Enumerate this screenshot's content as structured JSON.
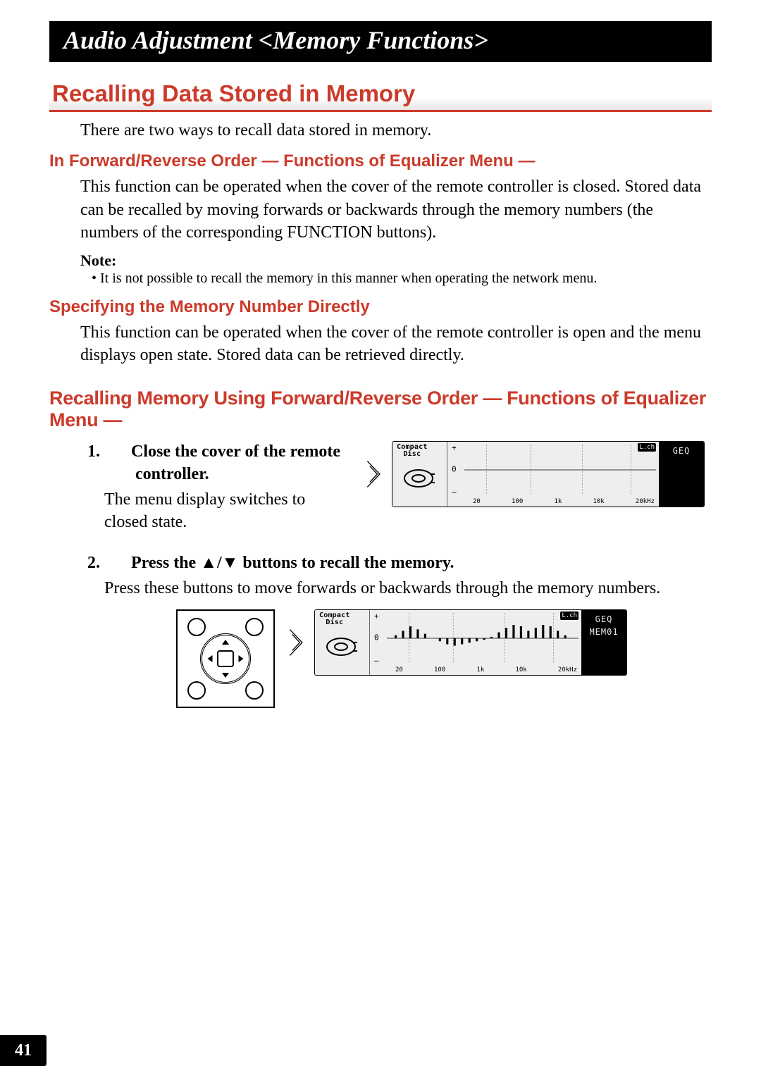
{
  "chapter_title": "Audio Adjustment <Memory Functions>",
  "section_title": "Recalling Data Stored in Memory",
  "intro_text": "There are two ways to recall data stored in memory.",
  "sub1": {
    "heading": "In Forward/Reverse Order — Functions of Equalizer Menu —",
    "body": "This function can be operated when the cover of the remote controller is closed. Stored data can be recalled by moving forwards or backwards through the memory numbers (the numbers of the corresponding FUNCTION buttons).",
    "note_label": "Note:",
    "note_text": "It is not possible to recall the memory in this manner when operating the network menu."
  },
  "sub2": {
    "heading": "Specifying the Memory Number Directly",
    "body": "This function can be operated when the cover of the remote controller is open and the menu displays open state. Stored data can be retrieved directly."
  },
  "procedure_heading": "Recalling Memory Using Forward/Reverse Order — Functions of Equalizer Menu —",
  "step1": {
    "num": "1.",
    "head": "Close the cover of the remote controller.",
    "body": "The menu display switches to closed state."
  },
  "step2": {
    "num": "2.",
    "head": "Press the ▲/▼ buttons to recall the memory.",
    "body": "Press these buttons to move forwards or backwards through the memory numbers."
  },
  "display": {
    "source": "Compact Disc",
    "channel": "L.ch",
    "geq": "GEQ",
    "mem": "MEM01",
    "axis_plus": "+",
    "axis_zero": "0",
    "axis_minus": "–",
    "freq_labels": [
      "20",
      "100",
      "1k",
      "10k",
      "20kHz"
    ]
  },
  "page_number": "41"
}
